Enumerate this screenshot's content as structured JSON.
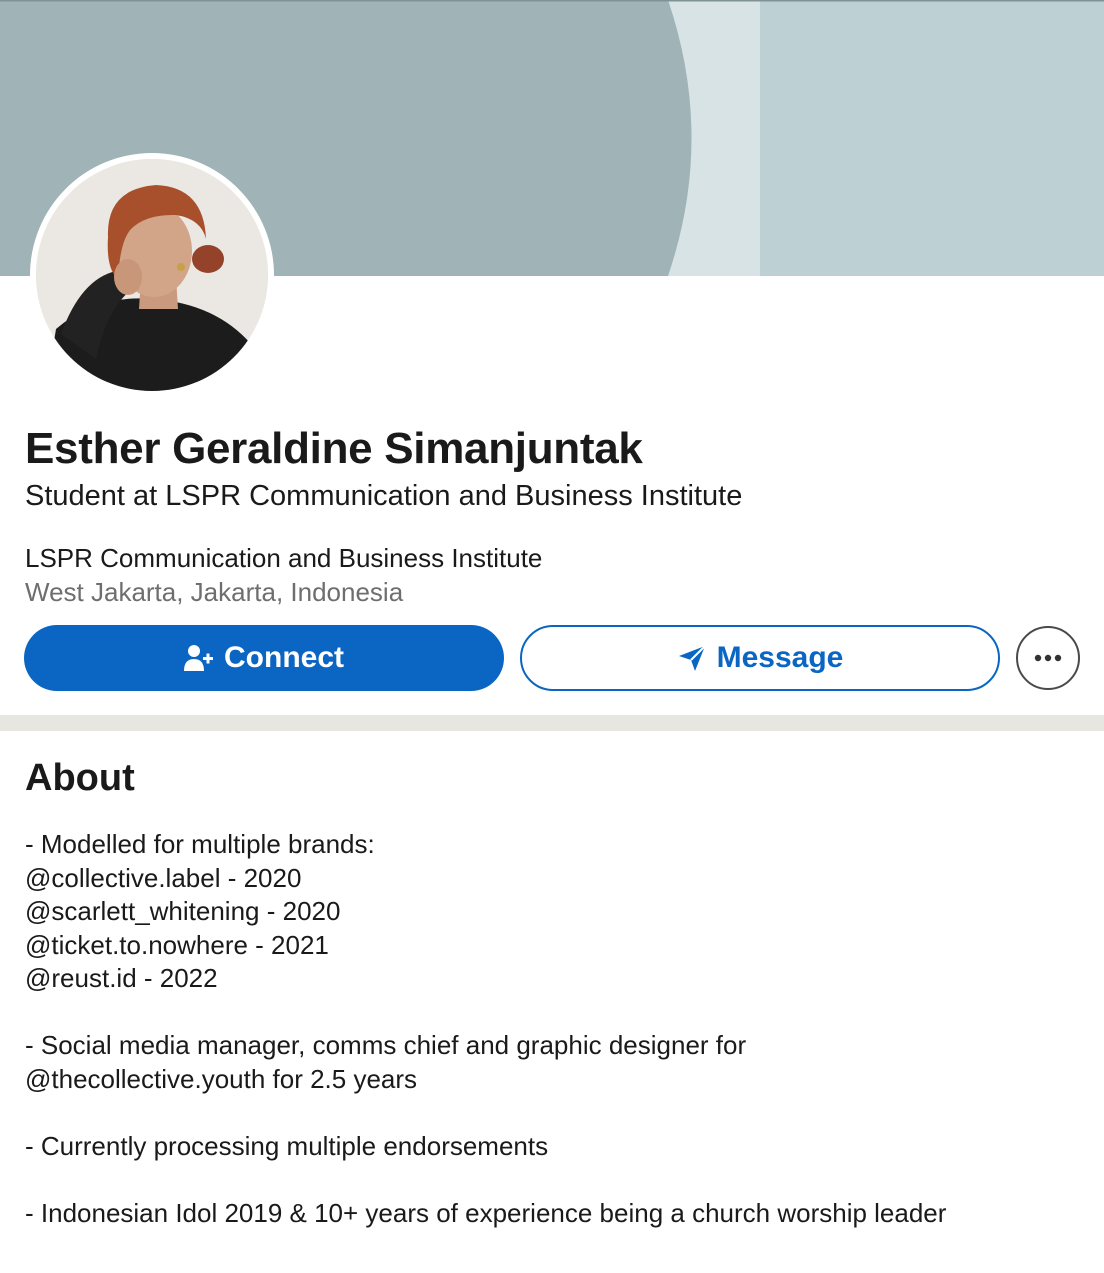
{
  "profile": {
    "name": "Esther Geraldine Simanjuntak",
    "headline": "Student at LSPR Communication and Business Institute",
    "organization": "LSPR Communication and Business Institute",
    "location": "West Jakarta, Jakarta, Indonesia"
  },
  "actions": {
    "connect_label": "Connect",
    "message_label": "Message"
  },
  "about": {
    "title": "About",
    "text": "- Modelled for multiple brands:\n@collective.label - 2020\n@scarlett_whitening - 2020\n@ticket.to.nowhere - 2021\n@reust.id - 2022\n\n- Social media manager, comms chief and graphic designer for\n@thecollective.youth for 2.5 years\n\n- Currently processing multiple endorsements\n\n- Indonesian Idol 2019 & 10+ years of experience being a church worship leader"
  },
  "colors": {
    "brand_blue": "#0a66c2",
    "banner_dark": "#a0b3b6",
    "banner_light": "#bdd1d5",
    "divider": "#e8e6e1"
  },
  "icons": {
    "connect": "add-person-icon",
    "message": "send-icon",
    "more": "more-horizontal-icon"
  }
}
